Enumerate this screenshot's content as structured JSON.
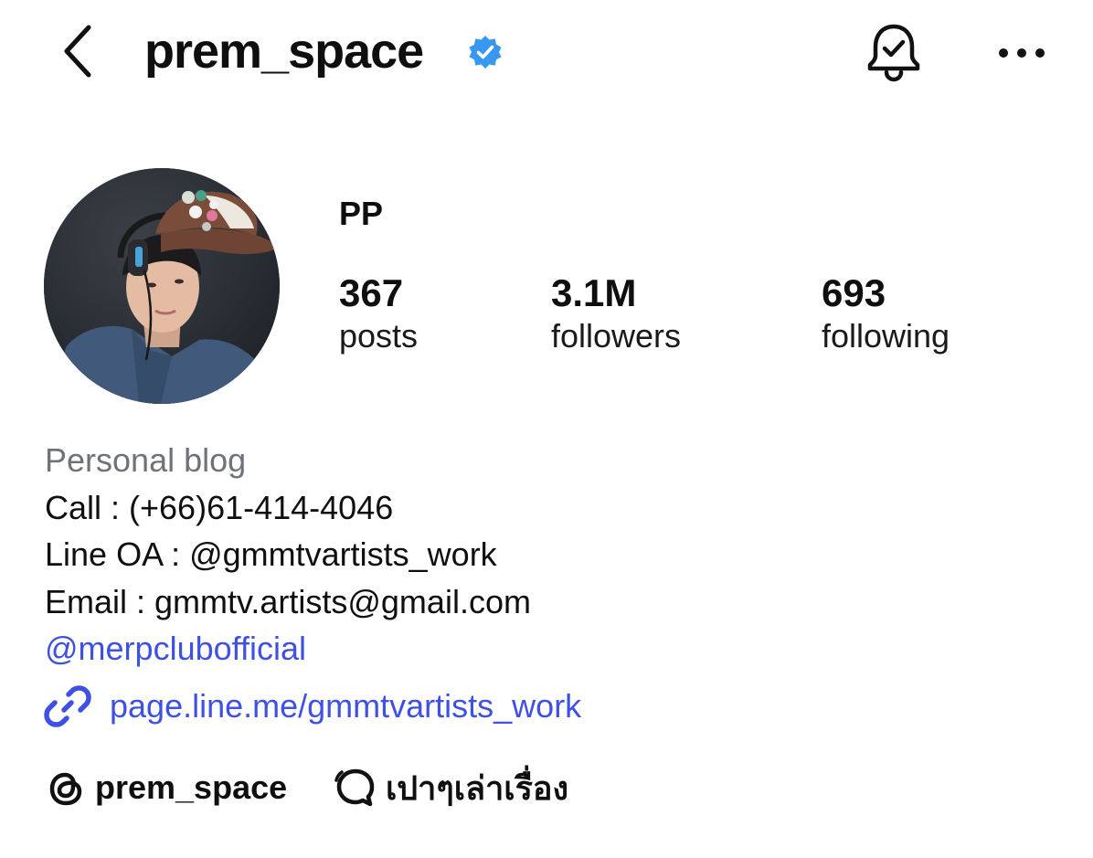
{
  "header": {
    "back_icon": "chevron-left-icon",
    "username": "prem_space",
    "verified_icon": "verified-badge-icon",
    "verified_color": "#3897f0",
    "notification_icon": "bell-check-icon",
    "more_icon": "more-horizontal-icon"
  },
  "profile": {
    "avatar_alt": "profile photo",
    "display_name": "PP",
    "stats": [
      {
        "value": "367",
        "label": "posts"
      },
      {
        "value": "3.1M",
        "label": "followers"
      },
      {
        "value": "693",
        "label": "following"
      }
    ]
  },
  "bio": {
    "category": "Personal blog",
    "lines": [
      "Call : (+66)61-414-4046",
      "Line OA : @gmmtvartists_work",
      "Email : gmmtv.artists@gmail.com"
    ],
    "mention": "@merpclubofficial",
    "link_icon": "link-icon",
    "link_text": "page.line.me/gmmtvartists_work",
    "link_color": "#3f51e0"
  },
  "chips": {
    "threads_icon": "threads-icon",
    "threads_label": "prem_space",
    "chat_icon": "chat-bubble-icon",
    "chat_label": "เปาๆเล่าเรื่อง"
  }
}
